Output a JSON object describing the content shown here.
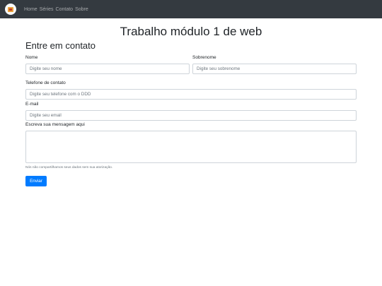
{
  "nav": {
    "links": [
      "Home",
      "Séries",
      "Contato",
      "Sobre"
    ]
  },
  "page_title": "Trabalho módulo 1 de web",
  "section_title": "Entre em contato",
  "form": {
    "nome_label": "Nome",
    "nome_placeholder": "Digite seu nome",
    "sobrenome_label": "Sobrenome",
    "sobrenome_placeholder": "Digite seu sobrenome",
    "telefone_label": "Telefone de contato",
    "telefone_placeholder": "Digite seu telefone com o DDD",
    "email_label": "E-mail",
    "email_placeholder": "Digite seu email",
    "mensagem_label": "Escreva sua mensagem aqui",
    "help_text": "Nós não compartilhamos seus dados sem sua atorização.",
    "submit_label": "Enviar"
  },
  "colors": {
    "navbar": "#343a40",
    "primary": "#007bff"
  }
}
